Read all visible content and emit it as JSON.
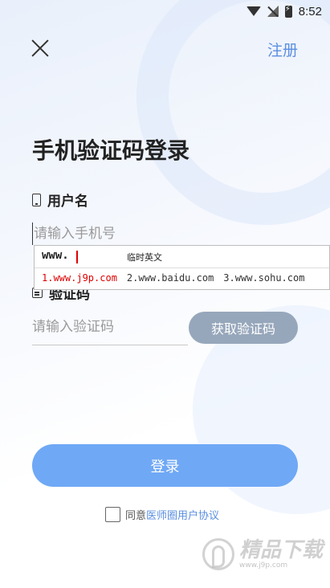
{
  "status_bar": {
    "time": "8:52"
  },
  "header": {
    "register_label": "注册"
  },
  "title": "手机验证码登录",
  "username": {
    "label": "用户名",
    "placeholder": "请输入手机号"
  },
  "code": {
    "label": "验证码",
    "placeholder": "请输入验证码",
    "get_code_label": "获取验证码"
  },
  "login": {
    "label": "登录"
  },
  "agreement": {
    "prefix": "同意",
    "link": "医师圈用户协议"
  },
  "ime": {
    "composing": "www.",
    "mode": "临时英文",
    "candidates": [
      "1.www.j9p.com",
      "2.www.baidu.com",
      "3.www.sohu.com"
    ]
  },
  "watermark": {
    "main": "精品下载",
    "url": "www.j9p.com"
  },
  "colors": {
    "accent": "#5a8fe0",
    "login_button": "#6fa8f5",
    "get_code_button": "#97a7bb"
  }
}
